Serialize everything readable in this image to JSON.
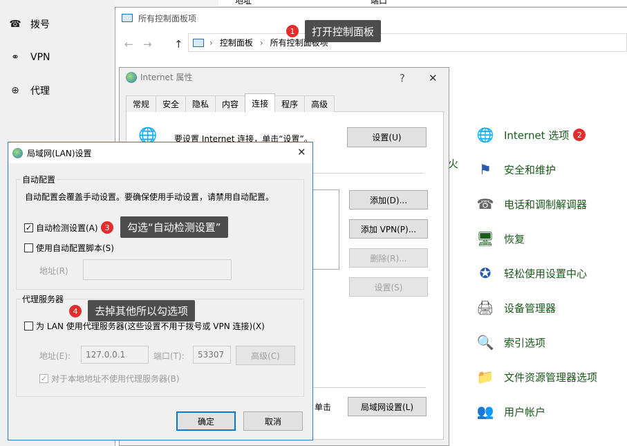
{
  "settings_nav": {
    "items": [
      {
        "icon": "dialup-icon",
        "glyph": "☎",
        "label": "拨号"
      },
      {
        "icon": "vpn-icon",
        "glyph": "⚭",
        "label": "VPN"
      },
      {
        "icon": "globe-icon",
        "glyph": "⊕",
        "label": "代理"
      }
    ]
  },
  "background_strip": {
    "col1": "地址",
    "col2": "端口"
  },
  "control_panel": {
    "title": "所有控制面板项",
    "breadcrumb": [
      "控制面板",
      "所有控制面板项"
    ],
    "nav": {
      "back": "←",
      "forward": "→",
      "up": "↑"
    },
    "items": [
      {
        "icon": "internet-options-icon",
        "glyph": "🌐",
        "label": "Internet 选项"
      },
      {
        "icon": "security-maintenance-icon",
        "glyph": "⚑",
        "label": "安全和维护"
      },
      {
        "icon": "phone-modem-icon",
        "glyph": "☎",
        "label": "电话和调制解调器"
      },
      {
        "icon": "recovery-icon",
        "glyph": "🖥",
        "label": "恢复"
      },
      {
        "icon": "ease-of-access-icon",
        "glyph": "✪",
        "label": "轻松使用设置中心"
      },
      {
        "icon": "device-manager-icon",
        "glyph": "🖨",
        "label": "设备管理器"
      },
      {
        "icon": "indexing-options-icon",
        "glyph": "🔍",
        "label": "索引选项"
      },
      {
        "icon": "file-explorer-options-icon",
        "glyph": "📁",
        "label": "文件资源管理器选项"
      },
      {
        "icon": "user-accounts-icon",
        "glyph": "👥",
        "label": "用户帐户"
      }
    ],
    "partial_text": "火"
  },
  "callouts": {
    "c1": {
      "num": "1",
      "text": "打开控制面板"
    },
    "c2": {
      "num": "2"
    },
    "c3": {
      "num": "3",
      "text": "勾选“自动检测设置”"
    },
    "c4": {
      "num": "4",
      "text": "去掉其他所以勾选项"
    }
  },
  "internet_properties": {
    "title": "Internet 属性",
    "help": "?",
    "close": "✕",
    "tabs": [
      "常规",
      "安全",
      "隐私",
      "内容",
      "连接",
      "程序",
      "高级"
    ],
    "active_tab": "连接",
    "setup_text": "要设置 Internet 连接，单击“设置”。",
    "setup_button": "设置(U)",
    "add_button": "添加(D)...",
    "add_vpn_button": "添加 VPN(P)...",
    "remove_button": "删除(R)...",
    "settings_button": "设置(S)",
    "lan_text": "单击",
    "lan_button": "局域网设置(L)"
  },
  "lan_dialog": {
    "title": "局域网(LAN)设置",
    "close": "✕",
    "auto_group": {
      "label": "自动配置",
      "description": "自动配置会覆盖手动设置。要确保使用手动设置，请禁用自动配置。",
      "auto_detect": {
        "label": "自动检测设置(A)",
        "checked": true
      },
      "auto_script": {
        "label": "使用自动配置脚本(S)",
        "checked": false
      },
      "address_label": "地址(R)",
      "address_value": ""
    },
    "proxy_group": {
      "label": "代理服务器",
      "use_proxy": {
        "label": "为 LAN 使用代理服务器(这些设置不用于拨号或 VPN 连接)(X)",
        "checked": false
      },
      "address_label": "地址(E):",
      "address_value": "127.0.0.1",
      "port_label": "端口(T):",
      "port_value": "53307",
      "advanced_button": "高级(C)",
      "bypass_local": {
        "label": "对于本地地址不使用代理服务器(B)",
        "checked": true
      }
    },
    "ok_button": "确定",
    "cancel_button": "取消"
  }
}
